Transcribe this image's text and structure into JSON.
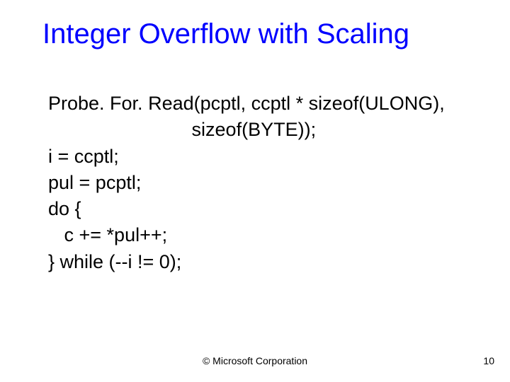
{
  "slide": {
    "title": "Integer Overflow with Scaling",
    "body_lines": [
      "Probe. For. Read(pcptl, ccptl * sizeof(ULONG),",
      "                           sizeof(BYTE));",
      "i = ccptl;",
      "pul = pcptl;",
      "do {",
      "   c += *pul++;",
      "} while (--i != 0);"
    ],
    "footer_center": "© Microsoft Corporation",
    "footer_right": "10"
  }
}
